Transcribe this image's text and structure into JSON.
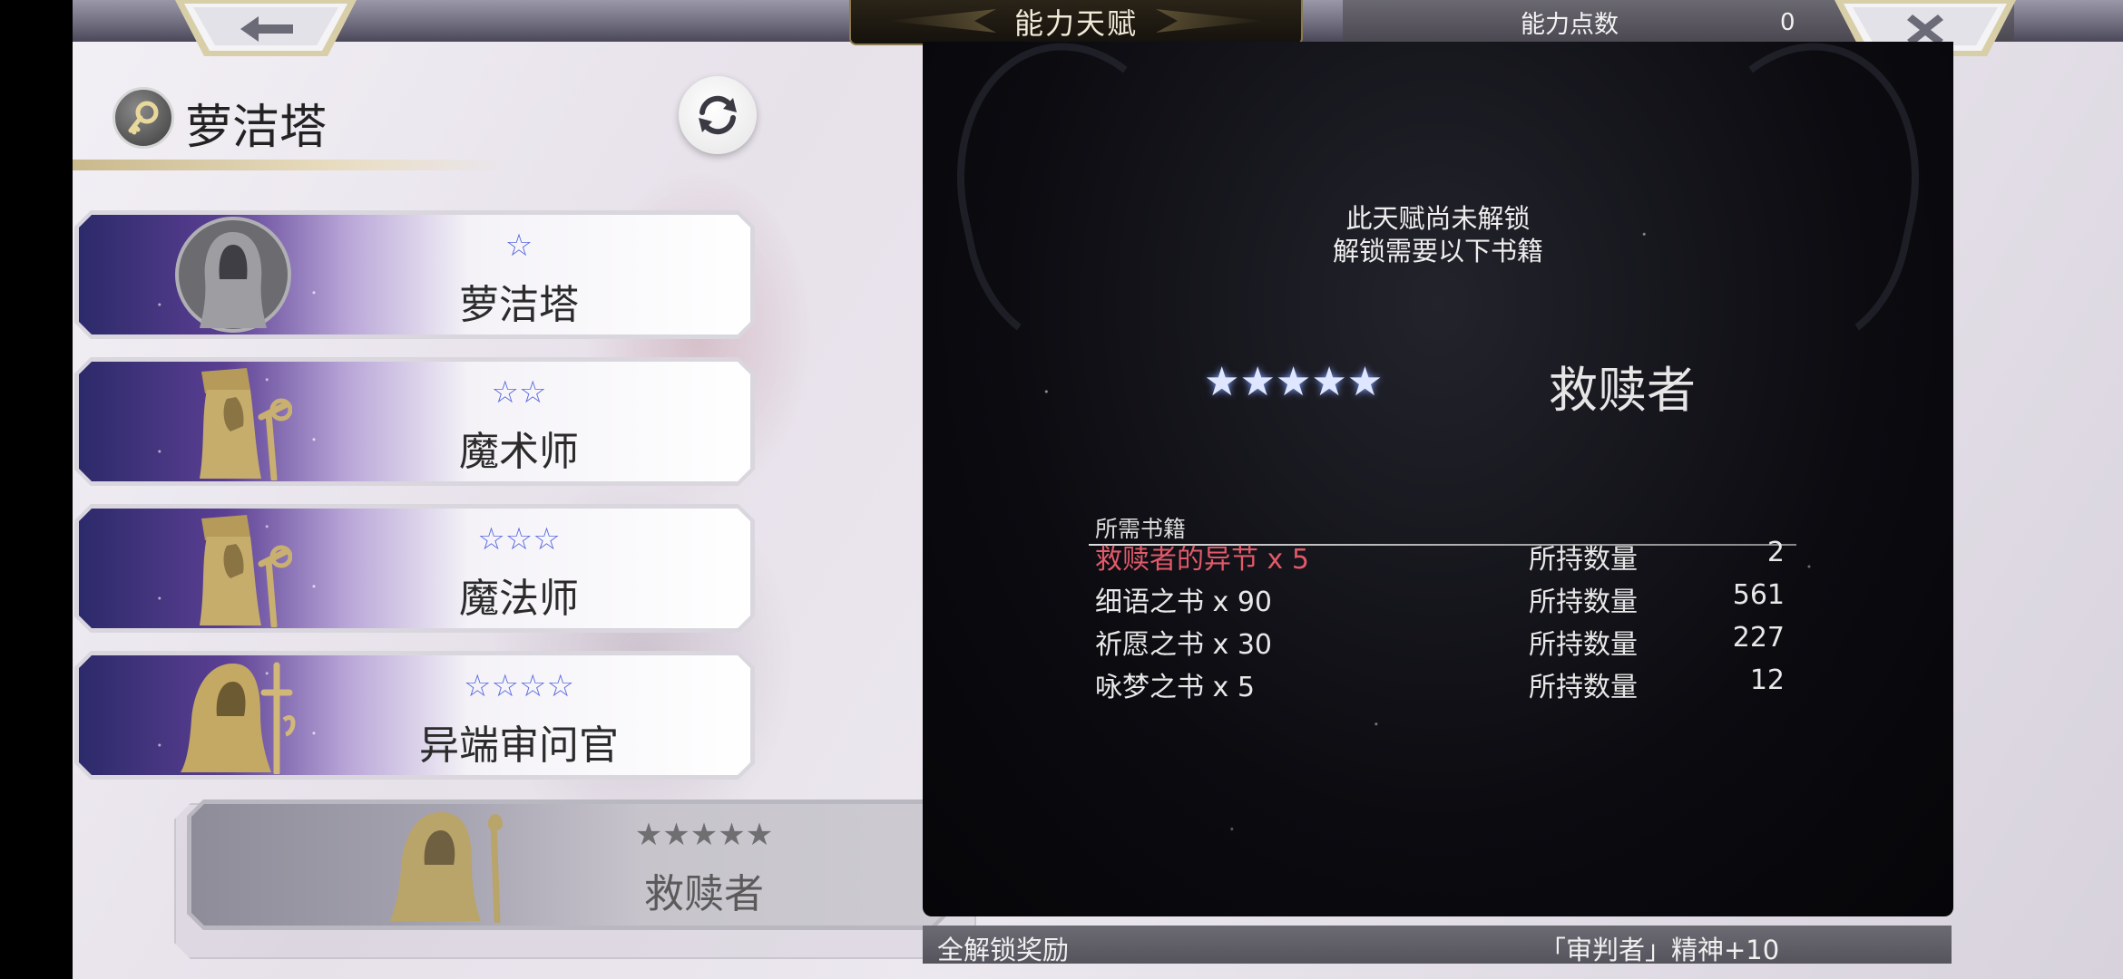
{
  "header": {
    "title": "能力天赋",
    "points_label": "能力点数",
    "points_value": "0",
    "back_icon": "arrow-left-icon",
    "close_icon": "close-x-icon"
  },
  "character": {
    "name": "萝洁塔",
    "icon": "key-icon",
    "refresh_icon": "refresh-icon"
  },
  "talents": [
    {
      "name": "萝洁塔",
      "stars": "☆",
      "locked": false
    },
    {
      "name": "魔术师",
      "stars": "☆☆",
      "locked": false
    },
    {
      "name": "魔法师",
      "stars": "☆☆☆",
      "locked": false
    },
    {
      "name": "异端审问官",
      "stars": "☆☆☆☆",
      "locked": false
    },
    {
      "name": "救赎者",
      "stars": "★★★★★",
      "locked": true
    }
  ],
  "detail": {
    "locked_line1": "此天赋尚未解锁",
    "locked_line2": "解锁需要以下书籍",
    "stars": "★★★★★",
    "talent_name": "救赎者",
    "required_header": "所需书籍",
    "books": [
      {
        "name": "救赎者的异节 x 5",
        "owned_label": "所持数量",
        "owned": "2",
        "insufficient": true
      },
      {
        "name": "细语之书 x 90",
        "owned_label": "所持数量",
        "owned": "561",
        "insufficient": false
      },
      {
        "name": "祈愿之书 x 30",
        "owned_label": "所持数量",
        "owned": "227",
        "insufficient": false
      },
      {
        "name": "咏梦之书 x 5",
        "owned_label": "所持数量",
        "owned": "12",
        "insufficient": false
      }
    ]
  },
  "reward": {
    "label": "全解锁奖励",
    "value": "「审判者」精神+10"
  },
  "colors": {
    "insufficient": "#e05a6a",
    "star_blue": "#5b6be0",
    "panel_bg": "#0b0b10"
  }
}
